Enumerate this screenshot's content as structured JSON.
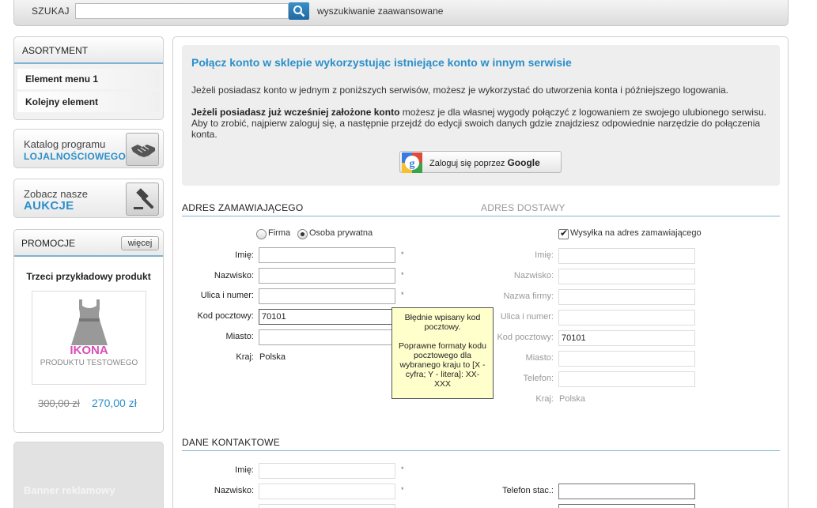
{
  "search": {
    "label": "SZUKAJ",
    "value": "",
    "advanced": "wyszukiwanie zaawansowane"
  },
  "sidebar": {
    "assortment_title": "ASORTYMENT",
    "items": [
      {
        "label": "Element menu 1"
      },
      {
        "label": "Kolejny element"
      }
    ],
    "loyalty": {
      "line1": "Katalog programu",
      "line2": "LOJALNOŚCIOWEGO"
    },
    "auctions": {
      "line1": "Zobacz nasze",
      "line2": "AUKCJE"
    },
    "promotions": {
      "title": "PROMOCJE",
      "more": "więcej",
      "product_name": "Trzeci przykładowy produkt",
      "image_title": "IKONA",
      "image_subtitle": "PRODUKTU TESTOWEGO",
      "old_price": "300,00 zł",
      "new_price": "270,00 zł"
    },
    "banner": "Banner reklamowy"
  },
  "connect": {
    "title": "Połącz konto w sklepie wykorzystując istniejące konto w innym serwisie",
    "p1": "Jeżeli posiadasz konto w jednym z poniższych serwisów, możesz je wykorzystać do utworzenia konta i późniejszego logowania.",
    "p2_bold": "Jeżeli posiadasz już wcześniej założone konto",
    "p2_rest": " możesz je dla własnej wygody połączyć z logowaniem ze swojego ulubionego serwisu. Aby to zrobić, najpierw zaloguj się, a następnie przejdź do edycji swoich danych gdzie znajdziesz odpowiednie narzędzie do połączenia konta.",
    "google_prefix": "Zaloguj się poprzez ",
    "google_name": "Google"
  },
  "orderer": {
    "title": "ADRES ZAMAWIAJĄCEGO",
    "type_company": "Firma",
    "type_person": "Osoba prywatna",
    "selected_type": "Osoba prywatna",
    "fields": {
      "first_name": {
        "label": "Imię:",
        "value": ""
      },
      "last_name": {
        "label": "Nazwisko:",
        "value": ""
      },
      "street": {
        "label": "Ulica i numer:",
        "value": ""
      },
      "postal": {
        "label": "Kod pocztowy:",
        "value": "70101"
      },
      "city": {
        "label": "Miasto:",
        "value": ""
      },
      "country": {
        "label": "Kraj:",
        "value": "Polska"
      }
    },
    "required_mark": "*"
  },
  "tooltip": {
    "line1": "Błędnie wpisany kod pocztowy.",
    "line2": "Poprawne formaty kodu pocztowego dla wybranego kraju to [X - cyfra; Y - litera]: XX-XXX"
  },
  "delivery": {
    "title": "ADRES DOSTAWY",
    "same_address": "Wysyłka na adres zamawiającego",
    "same_address_checked": true,
    "fields": {
      "first_name": {
        "label": "Imię:",
        "value": ""
      },
      "last_name": {
        "label": "Nazwisko:",
        "value": ""
      },
      "company": {
        "label": "Nazwa firmy:",
        "value": ""
      },
      "street": {
        "label": "Ulica i numer:",
        "value": ""
      },
      "postal": {
        "label": "Kod pocztowy:",
        "value": "70101"
      },
      "city": {
        "label": "Miasto:",
        "value": ""
      },
      "phone": {
        "label": "Telefon:",
        "value": ""
      },
      "country": {
        "label": "Kraj:",
        "value": "Polska"
      }
    }
  },
  "contact": {
    "title": "DANE KONTAKTOWE",
    "first_name": {
      "label": "Imię:",
      "value": ""
    },
    "last_name": {
      "label": "Nazwisko:",
      "value": ""
    },
    "phone_landline": {
      "label": "Telefon stac.:",
      "value": ""
    }
  },
  "colors": {
    "accent": "#2b8fc9",
    "section_line": "#7fb3d3",
    "tooltip_bg": "#ffffcc",
    "promo_pink": "#d84fb6"
  }
}
